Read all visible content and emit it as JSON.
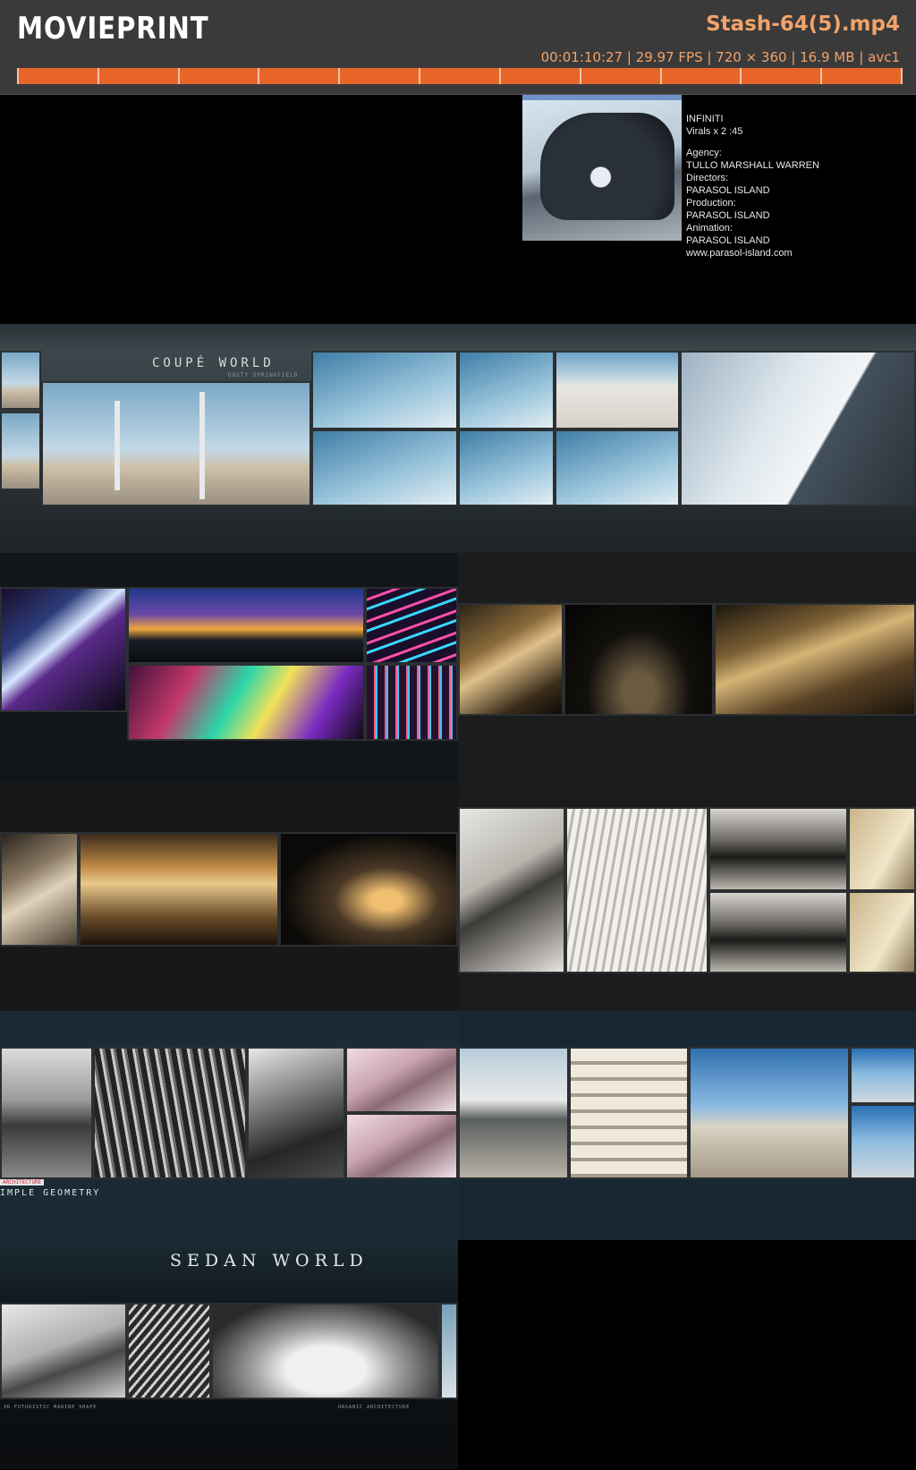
{
  "header": {
    "brand": "MOVIEPRINT",
    "filename": "Stash-64(5).mp4",
    "meta": "00:01:10:27 | 29.97 FPS | 720 × 360 | 16.9 MB | avc1",
    "timeline_segments": 11
  },
  "thumbs": {
    "credits": {
      "line1": "INFINITI",
      "line2": "Virals x 2 :45",
      "agency_label": "Agency:",
      "agency": "TULLO MARSHALL WARREN",
      "directors_label": "Directors:",
      "directors": "PARASOL ISLAND",
      "production_label": "Production:",
      "production": "PARASOL ISLAND",
      "animation_label": "Animation:",
      "animation": "PARASOL ISLAND",
      "url": "www.parasol-island.com"
    },
    "coupe": {
      "title": "COUPÉ WORLD",
      "subtitle": "DUSTY SPRINGFIELD"
    },
    "sedan": {
      "title": "SEDAN WORLD",
      "caption_right": "ORGANIC ARCHITECTURE",
      "caption_left": "3D FUTURISTIC MARINE SHAPE"
    },
    "geometry": {
      "tag": "ARCHITECTURE",
      "text": "IMPLE GEOMETRY"
    }
  },
  "colors": {
    "accent": "#e8652a",
    "header_bg": "#3a3a3a",
    "meta_text": "#f2a36a"
  }
}
